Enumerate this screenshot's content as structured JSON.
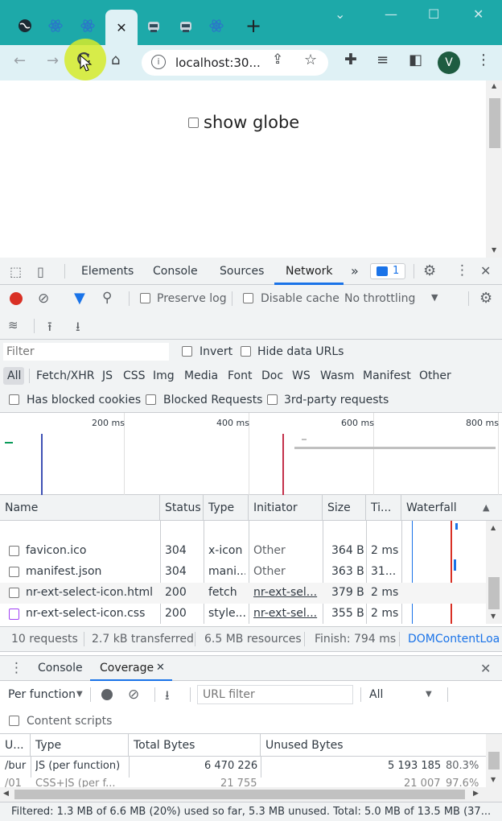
{
  "browser": {
    "url": "localhost:30...",
    "avatar_letter": "V",
    "new_tab": "+",
    "close_tab": "✕"
  },
  "page": {
    "checkbox_label": "show globe"
  },
  "devtools": {
    "tabs": [
      "Elements",
      "Console",
      "Sources",
      "Network"
    ],
    "more_tabs": "»",
    "issues_count": "1",
    "toolbar": {
      "preserve_log": "Preserve log",
      "disable_cache": "Disable cache",
      "throttling": "No throttling"
    },
    "filter": {
      "placeholder": "Filter",
      "invert": "Invert",
      "hide_data_urls": "Hide data URLs"
    },
    "type_filters": [
      "All",
      "Fetch/XHR",
      "JS",
      "CSS",
      "Img",
      "Media",
      "Font",
      "Doc",
      "WS",
      "Wasm",
      "Manifest",
      "Other"
    ],
    "checkboxes": [
      "Has blocked cookies",
      "Blocked Requests",
      "3rd-party requests"
    ],
    "timeline_ticks": [
      "200 ms",
      "400 ms",
      "600 ms",
      "800 ms"
    ],
    "columns": [
      "Name",
      "Status",
      "Type",
      "Initiator",
      "Size",
      "Ti...",
      "Waterfall"
    ],
    "rows": [
      {
        "name": "favicon.ico",
        "status": "304",
        "type": "x-icon",
        "initiator": "Other",
        "size": "364 B",
        "time": "2 ms"
      },
      {
        "name": "manifest.json",
        "status": "304",
        "type": "mani...",
        "initiator": "Other",
        "size": "363 B",
        "time": "31..."
      },
      {
        "name": "nr-ext-select-icon.html",
        "status": "200",
        "type": "fetch",
        "initiator": "nr-ext-sel...",
        "size": "379 B",
        "time": "2 ms"
      },
      {
        "name": "nr-ext-select-icon.css",
        "status": "200",
        "type": "style...",
        "initiator": "nr-ext-sel...",
        "size": "355 B",
        "time": "2 ms"
      }
    ],
    "summary": {
      "requests": "10 requests",
      "transferred": "2.7 kB transferred",
      "resources": "6.5 MB resources",
      "finish": "Finish: 794 ms",
      "dcl": "DOMContentLoa"
    },
    "drawer": {
      "tabs": [
        "Console",
        "Coverage"
      ],
      "per_function": "Per function",
      "url_filter_placeholder": "URL filter",
      "type_select": "All",
      "content_scripts": "Content scripts",
      "columns": [
        "U...",
        "Type",
        "Total Bytes",
        "Unused Bytes"
      ],
      "rows": [
        {
          "url": "/bur",
          "type": "JS (per function)",
          "total": "6 470 226",
          "unused": "5 193 185",
          "pct": "80.3%"
        },
        {
          "url": "/01",
          "type": "CSS+JS (per f...",
          "total": "21 755",
          "unused": "21 007",
          "pct": "97.6%"
        }
      ],
      "footer": "Filtered: 1.3 MB of 6.6 MB (20%) used so far, 5.3 MB unused. Total: 5.0 MB of 13.5 MB (37..."
    }
  },
  "colors": {
    "tabstrip": "#1da9a9",
    "toolbar": "#dff1f5",
    "accent_blue": "#1a73e8",
    "record_red": "#d93025"
  }
}
